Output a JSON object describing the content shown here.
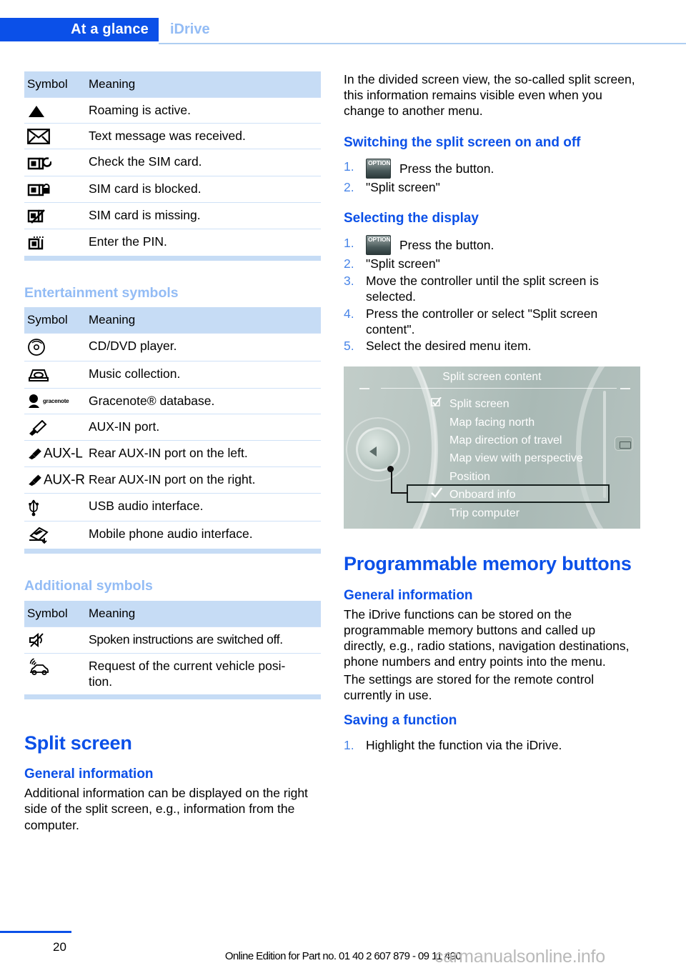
{
  "header": {
    "active_tab": "At a glance",
    "inactive_tab": "iDrive"
  },
  "tables": {
    "phone": {
      "col_symbol": "Symbol",
      "col_meaning": "Meaning",
      "rows": [
        {
          "icon": "roaming-triangle-icon",
          "meaning": "Roaming is active."
        },
        {
          "icon": "envelope-icon",
          "meaning": "Text message was received."
        },
        {
          "icon": "sim-check-icon",
          "meaning": "Check the SIM card."
        },
        {
          "icon": "sim-locked-icon",
          "meaning": "SIM card is blocked."
        },
        {
          "icon": "sim-missing-icon",
          "meaning": "SIM card is missing."
        },
        {
          "icon": "sim-pin-icon",
          "meaning": "Enter the PIN."
        }
      ]
    },
    "entertainment": {
      "heading": "Entertainment symbols",
      "col_symbol": "Symbol",
      "col_meaning": "Meaning",
      "rows": [
        {
          "icon": "cd-disc-icon",
          "label": "",
          "meaning": "CD/DVD player."
        },
        {
          "icon": "music-collection-icon",
          "label": "",
          "meaning": "Music collection."
        },
        {
          "icon": "gracenote-icon",
          "label": "gracenote",
          "meaning": "Gracenote® database."
        },
        {
          "icon": "aux-plug-icon",
          "label": "",
          "meaning": "AUX-IN port."
        },
        {
          "icon": "aux-plug-icon",
          "label": "AUX-L",
          "meaning": "Rear AUX-IN port on the left."
        },
        {
          "icon": "aux-plug-icon",
          "label": "AUX-R",
          "meaning": "Rear AUX-IN port on the right."
        },
        {
          "icon": "usb-icon",
          "label": "",
          "meaning": "USB audio interface."
        },
        {
          "icon": "phone-audio-interface-icon",
          "label": "",
          "meaning": "Mobile phone audio interface."
        }
      ]
    },
    "additional": {
      "heading": "Additional symbols",
      "col_symbol": "Symbol",
      "col_meaning": "Meaning",
      "rows": [
        {
          "icon": "speaker-muted-icon",
          "meaning": "Spoken instructions are switched off."
        },
        {
          "icon": "vehicle-position-icon",
          "meaning": "Request of the current vehicle posi-\ntion."
        }
      ]
    }
  },
  "left": {
    "split_screen_title": "Split screen",
    "general_info_heading": "General information",
    "general_info_body": "Additional information can be displayed on the right side of the split screen, e.g., information from the computer."
  },
  "right": {
    "intro": "In the divided screen view, the so-called split screen, this information remains visible even when you change to another menu.",
    "switching_heading": "Switching the split screen on and off",
    "switching_steps": [
      {
        "num": "1.",
        "button": "OPTION",
        "text": "Press the button."
      },
      {
        "num": "2.",
        "button": "",
        "text": "\"Split screen\""
      }
    ],
    "selecting_heading": "Selecting the display",
    "selecting_steps": [
      {
        "num": "1.",
        "button": "OPTION",
        "text": "Press the button."
      },
      {
        "num": "2.",
        "button": "",
        "text": "\"Split screen\""
      },
      {
        "num": "3.",
        "button": "",
        "text": "Move the controller until the split screen is selected."
      },
      {
        "num": "4.",
        "button": "",
        "text": "Press the controller or select \"Split screen content\"."
      },
      {
        "num": "5.",
        "button": "",
        "text": "Select the desired menu item."
      }
    ],
    "memory_title": "Programmable memory buttons",
    "memory_general_heading": "General information",
    "memory_body_1": "The iDrive functions can be stored on the programmable memory buttons and called up directly, e.g., radio stations, navigation destinations, phone numbers and entry points into the menu.",
    "memory_body_2": "The settings are stored for the remote control currently in use.",
    "saving_heading": "Saving a function",
    "saving_steps": [
      {
        "num": "1.",
        "button": "",
        "text": "Highlight the function via the iDrive."
      }
    ]
  },
  "idrive_screen": {
    "title": "Split screen content",
    "items": [
      {
        "mark": "checkbox",
        "label": "Split screen",
        "selected": false
      },
      {
        "mark": "",
        "label": "Map facing north",
        "selected": false
      },
      {
        "mark": "",
        "label": "Map direction of travel",
        "selected": false
      },
      {
        "mark": "",
        "label": "Map view with perspective",
        "selected": false
      },
      {
        "mark": "",
        "label": "Position",
        "selected": false
      },
      {
        "mark": "check",
        "label": "Onboard info",
        "selected": true
      },
      {
        "mark": "",
        "label": "Trip computer",
        "selected": false
      }
    ]
  },
  "footer": {
    "page_number": "20",
    "edition_line": "Online Edition for Part no. 01 40 2 607 879 - 09 11 490",
    "watermark": "carmanualsonline.info"
  },
  "colors": {
    "brand_blue": "#0b50e8",
    "light_blue": "#93bcf5",
    "table_header": "#c6dcf5",
    "rule": "#cfe1f7"
  }
}
